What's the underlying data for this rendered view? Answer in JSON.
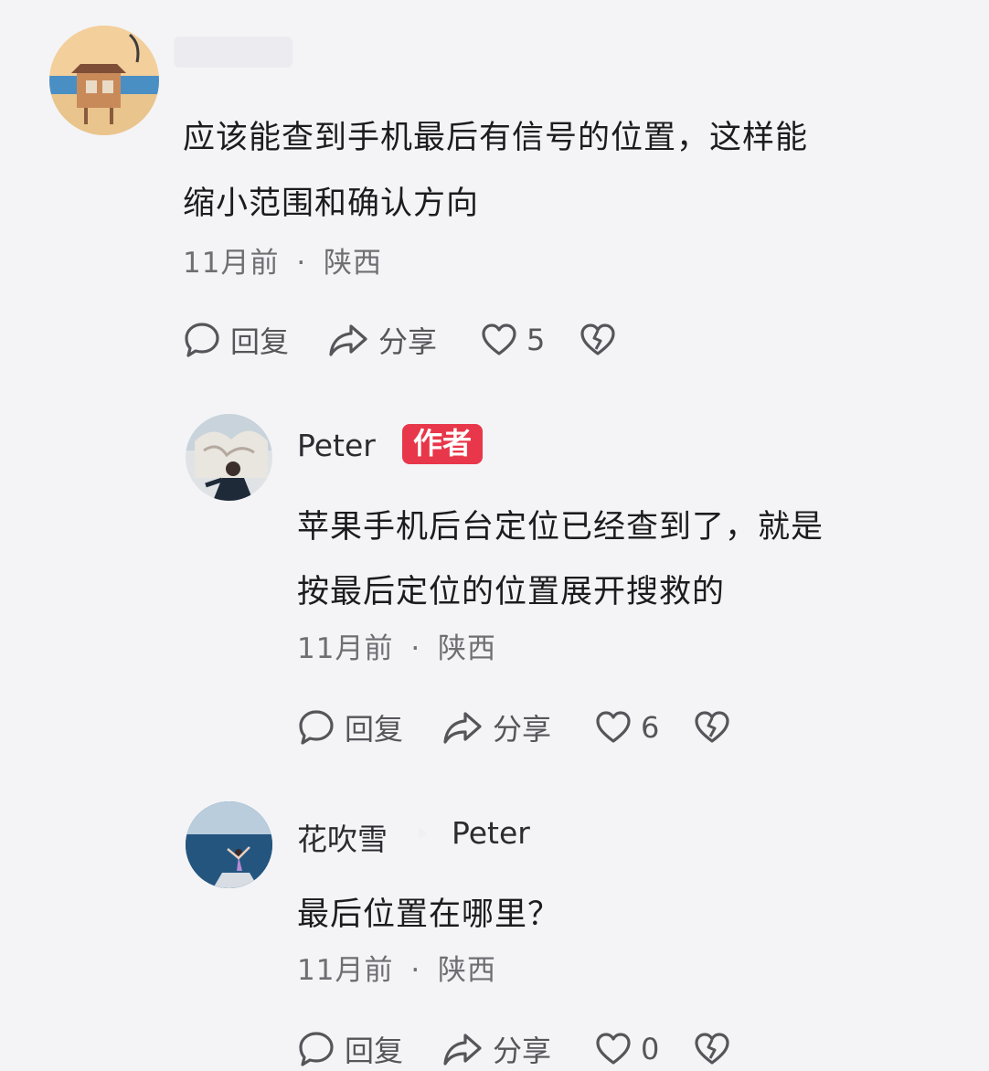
{
  "comments": [
    {
      "username": "",
      "text_lines": [
        "应该能查到手机最后有信号的位置，这样能",
        "缩小范围和确认方向"
      ],
      "time": "11月前",
      "separator": "·",
      "location": "陕西",
      "actions": {
        "reply": "回复",
        "share": "分享",
        "like_count": "5"
      }
    },
    {
      "username": "Peter",
      "badge": "作者",
      "text_lines": [
        "苹果手机后台定位已经查到了，就是",
        "按最后定位的位置展开搜救的"
      ],
      "time": "11月前",
      "separator": "·",
      "location": "陕西",
      "actions": {
        "reply": "回复",
        "share": "分享",
        "like_count": "6"
      }
    },
    {
      "username": "花吹雪",
      "reply_to": "Peter",
      "text_lines": [
        "最后位置在哪里？"
      ],
      "time": "11月前",
      "separator": "·",
      "location": "陕西",
      "actions": {
        "reply": "回复",
        "share": "分享",
        "like_count": "0"
      }
    }
  ],
  "icons": {
    "reply": "comment-bubble-icon",
    "share": "share-arrow-icon",
    "like": "heart-outline-icon",
    "dislike": "broken-heart-icon",
    "reply_to": "reply-triangle-icon"
  },
  "colors": {
    "background": "#f4f4f7",
    "badge": "#e8374a",
    "meta_text": "#6e6e73",
    "icon": "#55555a"
  }
}
